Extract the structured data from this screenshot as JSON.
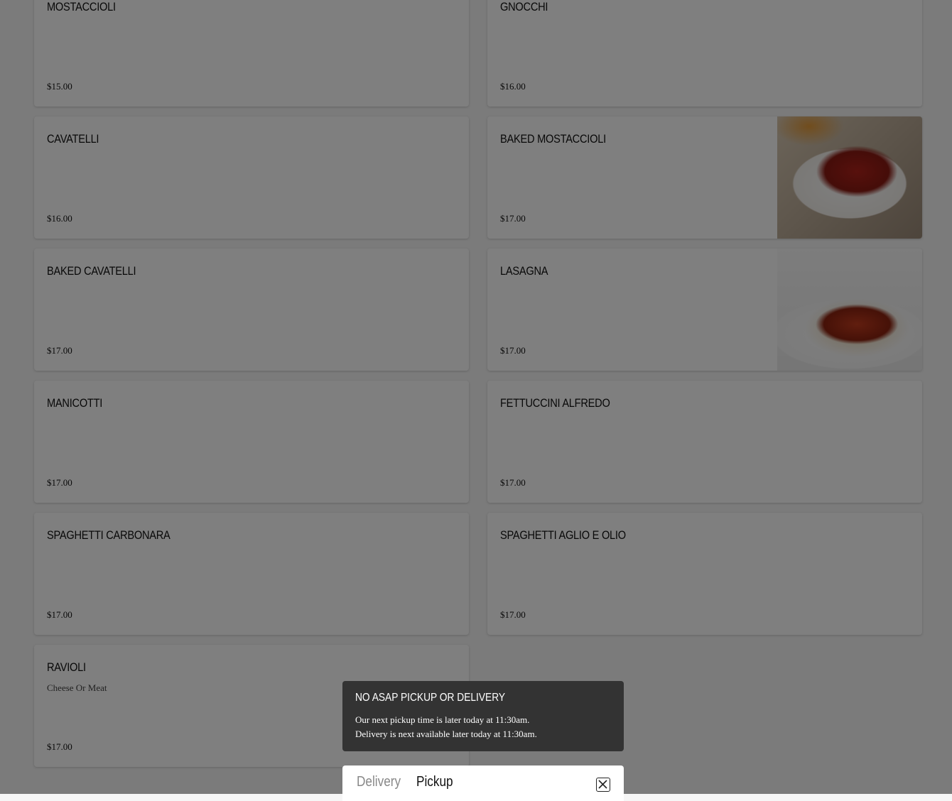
{
  "menu": {
    "items": [
      {
        "name": "MOSTACCIOLI",
        "description": "",
        "price": "$15.00",
        "photo": false
      },
      {
        "name": "GNOCCHI",
        "description": "",
        "price": "$16.00",
        "photo": false
      },
      {
        "name": "CAVATELLI",
        "description": "",
        "price": "$16.00",
        "photo": false
      },
      {
        "name": "BAKED MOSTACCIOLI",
        "description": "",
        "price": "$17.00",
        "photo": "baked"
      },
      {
        "name": "BAKED CAVATELLI",
        "description": "",
        "price": "$17.00",
        "photo": false
      },
      {
        "name": "LASAGNA",
        "description": "",
        "price": "$17.00",
        "photo": "lasagna"
      },
      {
        "name": "MANICOTTI",
        "description": "",
        "price": "$17.00",
        "photo": false
      },
      {
        "name": "FETTUCCINI ALFREDO",
        "description": "",
        "price": "$17.00",
        "photo": false
      },
      {
        "name": "SPAGHETTI CARBONARA",
        "description": "",
        "price": "$17.00",
        "photo": false
      },
      {
        "name": "SPAGHETTI AGLIO E OLIO",
        "description": "",
        "price": "$17.00",
        "photo": false
      },
      {
        "name": "RAVIOLI",
        "description": "Cheese Or Meat",
        "price": "$17.00",
        "photo": false
      }
    ]
  },
  "notice": {
    "title": "NO ASAP PICKUP OR DELIVERY",
    "line1": "Our next pickup time is later today at 11:30am.",
    "line2": "Delivery is next available later today at 11:30am."
  },
  "order_mode": {
    "delivery_label": "Delivery",
    "pickup_label": "Pickup",
    "selected": "Pickup"
  },
  "icons": {
    "close": "close-icon"
  }
}
